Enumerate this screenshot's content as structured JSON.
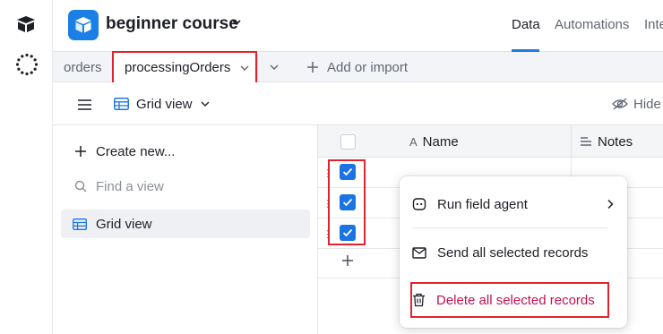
{
  "rail": {
    "logo_icon": "airtable-logo-icon",
    "spinner_icon": "loading-dots-icon"
  },
  "header": {
    "base_name": "beginner course",
    "tabs": [
      {
        "label": "Data",
        "active": true
      },
      {
        "label": "Automations",
        "active": false
      },
      {
        "label": "Inte",
        "active": false
      }
    ]
  },
  "tables": {
    "items": [
      {
        "label": "orders",
        "active": false
      },
      {
        "label": "processingOrders",
        "active": true
      }
    ],
    "add_label": "Add or import"
  },
  "viewbar": {
    "view_name": "Grid view",
    "hide_label": "Hide"
  },
  "sidebar": {
    "create_label": "Create new...",
    "find_placeholder": "Find a view",
    "views": [
      {
        "label": "Grid view",
        "selected": true
      }
    ]
  },
  "grid": {
    "columns": [
      {
        "label": "Name",
        "icon": "text-a-icon"
      },
      {
        "label": "Notes",
        "icon": "long-text-icon"
      }
    ],
    "rows": [
      {
        "checked": true
      },
      {
        "checked": true
      },
      {
        "checked": true
      }
    ]
  },
  "context_menu": {
    "items": [
      {
        "label": "Run field agent",
        "icon": "agent-icon",
        "has_submenu": true
      },
      {
        "label": "Send all selected records",
        "icon": "mail-icon"
      },
      {
        "label": "Delete all selected records",
        "icon": "trash-icon",
        "danger": true
      }
    ]
  },
  "colors": {
    "accent": "#1b80e5",
    "highlight": "#e0242f",
    "danger": "#c4124a"
  }
}
